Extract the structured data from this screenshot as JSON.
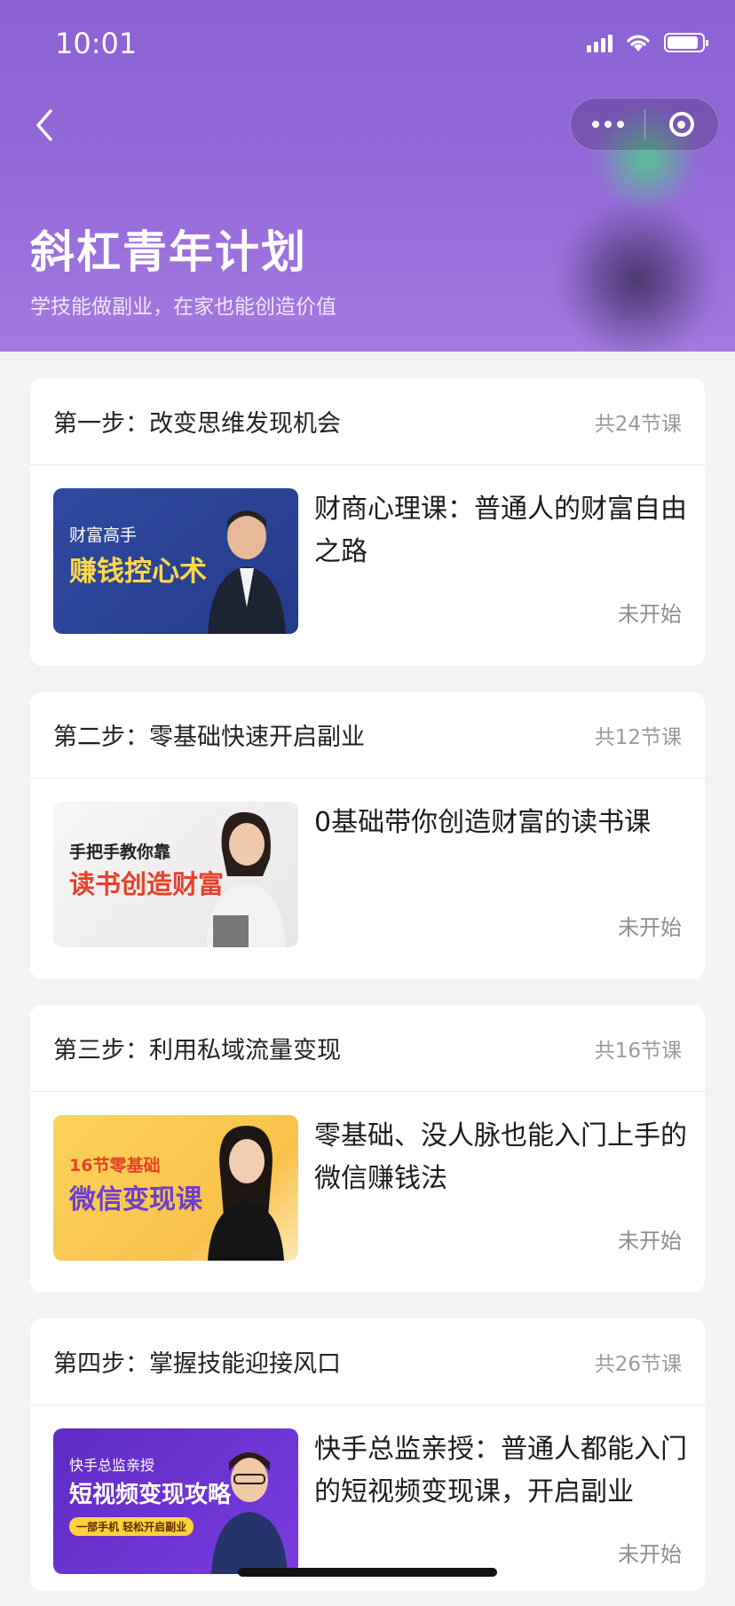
{
  "status_bar": {
    "time": "10:01"
  },
  "header": {
    "title": "斜杠青年计划",
    "subtitle": "学技能做副业，在家也能创造价值"
  },
  "steps": [
    {
      "step_title": "第一步：改变思维发现机会",
      "lesson_count": "共24节课",
      "course_title": "财商心理课：普通人的财富自由之路",
      "status": "未开始",
      "thumb_line1": "财富高手",
      "thumb_line2": "赚钱控心术"
    },
    {
      "step_title": "第二步：零基础快速开启副业",
      "lesson_count": "共12节课",
      "course_title": "0基础带你创造财富的读书课",
      "status": "未开始",
      "thumb_line1": "手把手教你靠",
      "thumb_line2": "读书创造财富"
    },
    {
      "step_title": "第三步：利用私域流量变现",
      "lesson_count": "共16节课",
      "course_title": "零基础、没人脉也能入门上手的微信赚钱法",
      "status": "未开始",
      "thumb_line1": "16节零基础",
      "thumb_line2": "微信变现课"
    },
    {
      "step_title": "第四步：掌握技能迎接风口",
      "lesson_count": "共26节课",
      "course_title": "快手总监亲授：普通人都能入门的短视频变现课，开启副业",
      "status": "未开始",
      "thumb_line1": "快手总监亲授",
      "thumb_line2": "短视频变现攻略",
      "thumb_line3": "一部手机 轻松开启副业"
    }
  ]
}
